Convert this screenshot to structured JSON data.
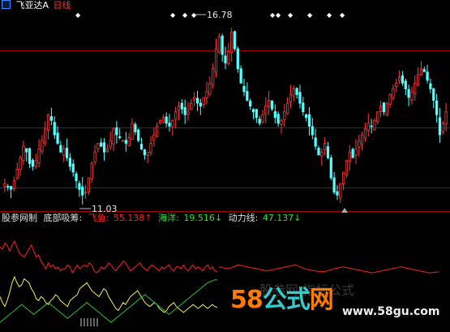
{
  "header": {
    "icon": "flag-icon",
    "stock_name": "飞亚达A",
    "period": "日线"
  },
  "price_labels": {
    "high": "16.78",
    "low": "11.03"
  },
  "indicator_header": {
    "source_label": "股参网制",
    "name": "底部吸筹:",
    "feiyu_label": "飞鱼:",
    "feiyu_value": "55.138↑",
    "haiyang_label": "海洋:",
    "haiyang_value": "19.516↓",
    "dongli_label": "动力线:",
    "dongli_value": "47.137↓"
  },
  "watermark": {
    "logo_digits": "58",
    "logo_cn1": "公式",
    "logo_cn2": "网",
    "url": "www.58gu.com",
    "ghost_text": "股参网 指标公式"
  },
  "colors": {
    "up": "#ff3c3c",
    "down": "#54ffff",
    "feiyu": "#ff2020",
    "haiyang": "#f0f060",
    "dongli": "#30c030",
    "grid": "#a00000",
    "header_red": "#ff3030",
    "logo_orange": "#ff7a00",
    "logo_teal": "#33cccc"
  },
  "chart_data": [
    {
      "type": "candlestick",
      "title": "飞亚达A 日线",
      "ylim": [
        10.6,
        17.5
      ],
      "gridlines": [
        16.15,
        13.45,
        11.35
      ],
      "closes": [
        11.5,
        11.4,
        11.3,
        11.6,
        12.0,
        12.4,
        12.8,
        12.6,
        12.2,
        12.1,
        12.3,
        12.7,
        13.0,
        13.4,
        13.9,
        13.7,
        13.2,
        12.9,
        12.6,
        12.7,
        12.4,
        12.1,
        11.9,
        11.6,
        11.3,
        11.1,
        11.2,
        11.7,
        12.2,
        12.6,
        12.9,
        12.8,
        12.6,
        12.7,
        13.0,
        13.4,
        13.2,
        13.1,
        13.0,
        12.9,
        13.1,
        13.6,
        13.3,
        13.0,
        12.7,
        12.5,
        12.6,
        12.9,
        13.2,
        13.5,
        13.7,
        13.8,
        13.6,
        13.5,
        13.7,
        14.0,
        14.2,
        14.1,
        13.9,
        14.0,
        14.3,
        14.5,
        14.3,
        14.2,
        14.5,
        14.7,
        15.0,
        15.5,
        16.2,
        16.6,
        16.0,
        15.7,
        16.1,
        16.78,
        16.2,
        15.5,
        15.0,
        14.7,
        14.4,
        14.2,
        14.0,
        13.8,
        13.6,
        13.9,
        14.2,
        14.4,
        14.1,
        13.8,
        13.6,
        13.7,
        14.0,
        14.3,
        14.6,
        14.8,
        14.6,
        14.3,
        14.0,
        13.8,
        13.5,
        13.2,
        12.8,
        12.5,
        12.6,
        12.9,
        12.4,
        11.7,
        11.2,
        11.1,
        11.5,
        11.9,
        12.3,
        12.6,
        12.4,
        12.7,
        13.0,
        13.2,
        13.4,
        13.6,
        13.5,
        13.7,
        14.0,
        14.2,
        14.0,
        14.3,
        14.6,
        14.8,
        15.0,
        15.2,
        15.0,
        14.8,
        14.5,
        14.7,
        15.0,
        15.3,
        15.5,
        15.4,
        15.1,
        14.8,
        14.4,
        13.9,
        13.2,
        13.6,
        14.0
      ],
      "top_markers": [
        "◆",
        "◆",
        "◆",
        "◆",
        "◆",
        "◆",
        "◆",
        "◆",
        "◆",
        "◆"
      ]
    },
    {
      "type": "line",
      "title": "底部吸筹",
      "ylim": [
        0,
        100
      ],
      "series": [
        {
          "name": "飞鱼",
          "values": [
            80,
            78,
            84,
            82,
            76,
            82,
            86,
            80,
            74,
            72,
            70,
            74,
            78,
            82,
            76,
            70,
            72,
            66,
            62,
            58,
            64,
            60,
            62,
            58,
            60,
            56,
            58,
            58,
            62,
            60,
            54,
            58,
            62,
            58,
            60,
            62,
            60,
            64,
            62,
            56,
            54,
            56,
            60,
            58,
            60,
            64,
            62,
            58,
            56,
            60,
            62,
            66,
            64,
            60,
            56,
            58,
            60,
            62,
            64,
            60,
            58,
            56,
            60,
            62,
            60,
            58,
            56,
            60,
            58,
            60,
            62,
            58,
            56,
            60,
            60,
            58,
            62,
            58,
            56,
            60,
            62,
            58,
            60,
            58,
            56,
            60,
            62,
            58,
            60,
            56,
            55
          ]
        },
        {
          "name": "海洋",
          "values": [
            30,
            24,
            20,
            26,
            34,
            44,
            50,
            44,
            40,
            42,
            48,
            46,
            44,
            38,
            34,
            28,
            26,
            30,
            28,
            24,
            22,
            26,
            28,
            32,
            30,
            26,
            24,
            22,
            20,
            26,
            28,
            30,
            32,
            38,
            40,
            42,
            44,
            40,
            36,
            34,
            32,
            30,
            34,
            38,
            36,
            30,
            26,
            22,
            18,
            16,
            20,
            24,
            22,
            26,
            30,
            32,
            34,
            36,
            32,
            28,
            24,
            22,
            20,
            22,
            24,
            22,
            18,
            16,
            14,
            16,
            20,
            22,
            24,
            20,
            18,
            16,
            14,
            16,
            18,
            20,
            22,
            20,
            18,
            20,
            22,
            20,
            18,
            20,
            22,
            20,
            19
          ]
        },
        {
          "name": "动力线",
          "values": [
            4,
            6,
            8,
            10,
            12,
            14,
            16,
            18,
            20,
            22,
            20,
            18,
            16,
            14,
            12,
            14,
            16,
            18,
            20,
            22,
            24,
            22,
            20,
            18,
            16,
            14,
            12,
            10,
            8,
            10,
            12,
            14,
            16,
            18,
            20,
            22,
            24,
            22,
            20,
            18,
            16,
            14,
            12,
            10,
            8,
            6,
            4,
            6,
            8,
            10,
            12,
            14,
            16,
            18,
            20,
            22,
            24,
            26,
            28,
            30,
            32,
            30,
            28,
            26,
            24,
            22,
            20,
            18,
            16,
            14,
            12,
            14,
            16,
            18,
            20,
            22,
            24,
            26,
            28,
            30,
            32,
            34,
            36,
            38,
            40,
            42,
            44,
            45,
            46,
            47,
            47
          ]
        }
      ]
    }
  ]
}
